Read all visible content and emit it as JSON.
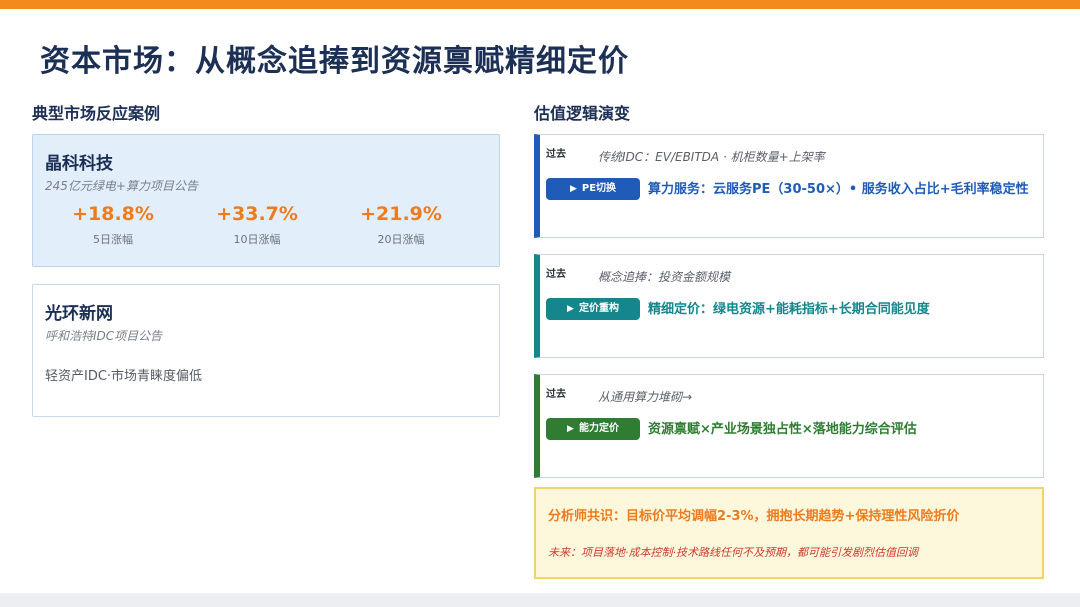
{
  "slide": {
    "title": "资本市场：从概念追捧到资源禀赋精细定价",
    "left_section_title": "典型市场反应案例",
    "right_section_title": "估值逻辑演变"
  },
  "colors": {
    "accent_orange": "#f28a1c",
    "navy": "#1c2f55",
    "blue": "#1f5cb8",
    "teal": "#14868c",
    "green": "#2f7d32",
    "red": "#d23a2e"
  },
  "cases": [
    {
      "name": "晶科科技",
      "subtitle": "245亿元绿电+算力项目公告",
      "stats": [
        {
          "value": "+18.8%",
          "label": "5日涨幅"
        },
        {
          "value": "+33.7%",
          "label": "10日涨幅"
        },
        {
          "value": "+21.9%",
          "label": "20日涨幅"
        }
      ]
    },
    {
      "name": "光环新网",
      "subtitle": "呼和浩特IDC项目公告",
      "note": "轻资产IDC·市场青睐度偏低"
    }
  ],
  "evolution": [
    {
      "past_label": "过去",
      "past_text": "传统IDC：EV/EBITDA · 机柜数量+上架率",
      "pill_icon": "play-triangle-icon",
      "pill_label": "PE切换",
      "now_text": "算力服务：云服务PE（30-50×）• 服务收入占比+毛利率稳定性"
    },
    {
      "past_label": "过去",
      "past_text": "概念追捧：投资金额规模",
      "pill_icon": "play-triangle-icon",
      "pill_label": "定价重构",
      "now_text": "精细定价：绿电资源+能耗指标+长期合同能见度"
    },
    {
      "past_label": "过去",
      "past_text": "从通用算力堆砌→",
      "pill_icon": "play-triangle-icon",
      "pill_label": "能力定价",
      "now_text": "资源禀赋×产业场景独占性×落地能力综合评估"
    }
  ],
  "consensus": {
    "main": "分析师共识：目标价平均调幅2-3%，拥抱长期趋势+保持理性风险折价",
    "note": "未来：项目落地·成本控制·技术路线任何不及预期，都可能引发剧烈估值回调"
  }
}
